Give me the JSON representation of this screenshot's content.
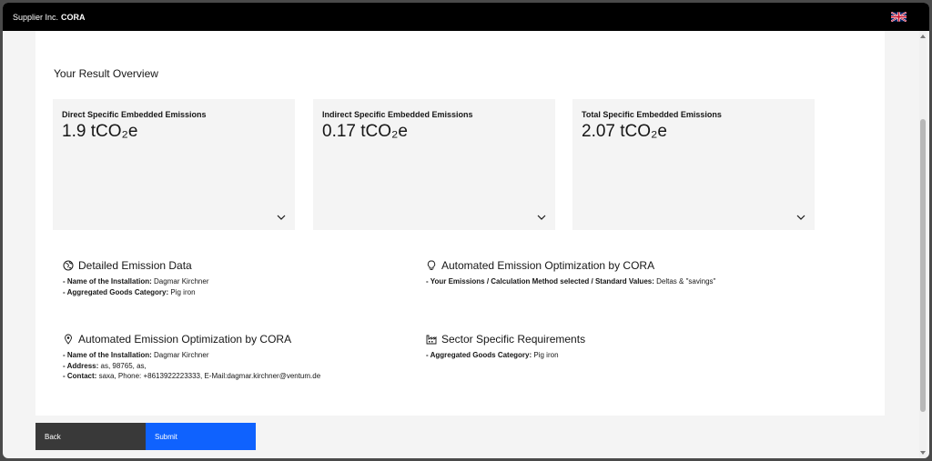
{
  "header": {
    "brand_prefix": "Supplier Inc.",
    "brand_name": "CORA",
    "language_icon": "uk-flag-icon"
  },
  "overview": {
    "title": "Your Result Overview",
    "cards": [
      {
        "label": "Direct Specific Embedded Emissions",
        "value": "1.9 tCO₂e"
      },
      {
        "label": "Indirect Specific Embedded Emissions",
        "value": "0.17 tCO₂e"
      },
      {
        "label": "Total Specific Embedded Emissions",
        "value": "2.07 tCO₂e"
      }
    ]
  },
  "sections": {
    "detailed": {
      "title": "Detailed Emission Data",
      "icon": "globe-icon",
      "lines": [
        {
          "key": "- Name of the Installation:",
          "value": "Dagmar Kirchner"
        },
        {
          "key": "- Aggregated Goods Category:",
          "value": "Pig iron"
        }
      ]
    },
    "optimization_top": {
      "title": "Automated Emission Optimization by CORA",
      "icon": "lightbulb-icon",
      "lines": [
        {
          "key": "- Your Emissions / Calculation Method selected / Standard Values:",
          "value": "Deltas & \"savings\""
        }
      ]
    },
    "optimization_bottom": {
      "title": "Automated Emission Optimization by CORA",
      "icon": "location-pin-icon",
      "lines": [
        {
          "key": "- Name of the Installation:",
          "value": "Dagmar Kirchner"
        },
        {
          "key": "- Address:",
          "value": "as, 98765, as,"
        },
        {
          "key": "- Contact:",
          "value": "saxa, Phone: +8613922223333, E-Mail:dagmar.kirchner@ventum.de"
        }
      ]
    },
    "sector": {
      "title": "Sector Specific Requirements",
      "icon": "factory-icon",
      "lines": [
        {
          "key": "- Aggregated Goods Category:",
          "value": "Pig iron"
        }
      ]
    }
  },
  "footer": {
    "back_label": "Back",
    "submit_label": "Submit"
  },
  "colors": {
    "header_bg": "#000000",
    "card_bg": "#f4f4f4",
    "back_bg": "#393939",
    "submit_bg": "#0f62fe"
  }
}
